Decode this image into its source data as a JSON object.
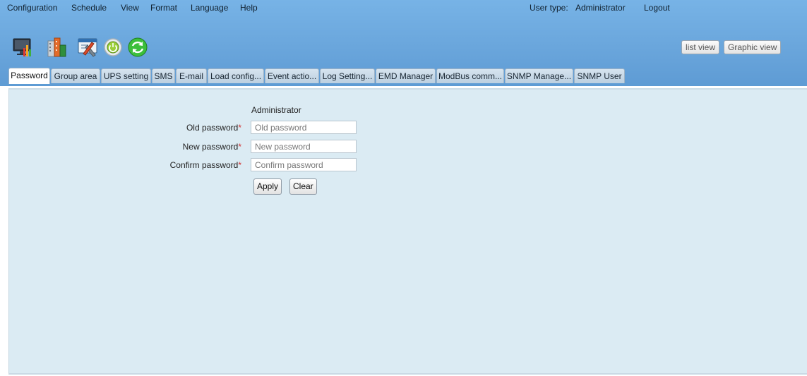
{
  "menu": {
    "items": [
      "Configuration",
      "Schedule",
      "View",
      "Format",
      "Language",
      "Help"
    ]
  },
  "user": {
    "label": "User type:",
    "type": "Administrator",
    "logout": "Logout"
  },
  "toolbar": {
    "icons": [
      "monitor-chart-icon",
      "buildings-icon",
      "tools-icon",
      "power-button-icon",
      "refresh-icon"
    ]
  },
  "views": {
    "list": "list view",
    "graphic": "Graphic view"
  },
  "tabs": [
    "Password",
    "Group area",
    "UPS setting",
    "SMS",
    "E-mail",
    "Load config...",
    "Event actio...",
    "Log Setting...",
    "EMD Manager",
    "ModBus comm...",
    "SNMP Manage...",
    "SNMP User"
  ],
  "form": {
    "title": "Administrator",
    "old_label": "Old password",
    "old_placeholder": "Old password",
    "new_label": "New password",
    "new_placeholder": "New password",
    "confirm_label": "Confirm password",
    "confirm_placeholder": "Confirm password",
    "required_mark": "*",
    "apply": "Apply",
    "clear": "Clear"
  },
  "colors": {
    "header": "#6aa6dc",
    "content": "#dbebf3",
    "required": "#d03030"
  }
}
